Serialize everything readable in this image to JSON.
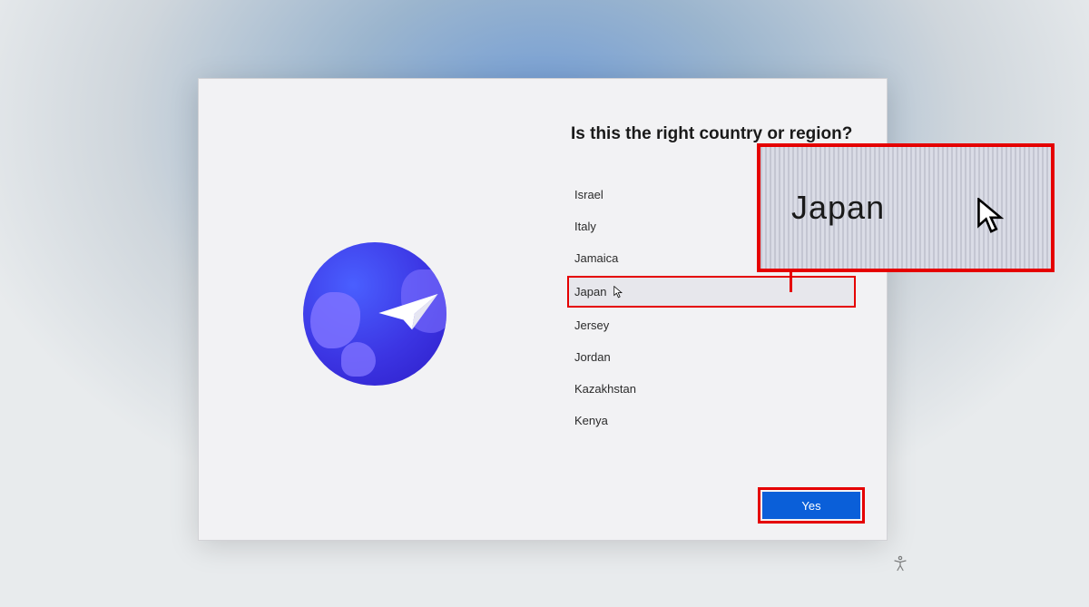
{
  "heading": "Is this the right country or region?",
  "countries": {
    "item0": "Israel",
    "item1": "Italy",
    "item2": "Jamaica",
    "item3": "Japan",
    "item4": "Jersey",
    "item5": "Jordan",
    "item6": "Kazakhstan",
    "item7": "Kenya"
  },
  "selected_country": "Japan",
  "zoom_label": "Japan",
  "yes_button": "Yes"
}
